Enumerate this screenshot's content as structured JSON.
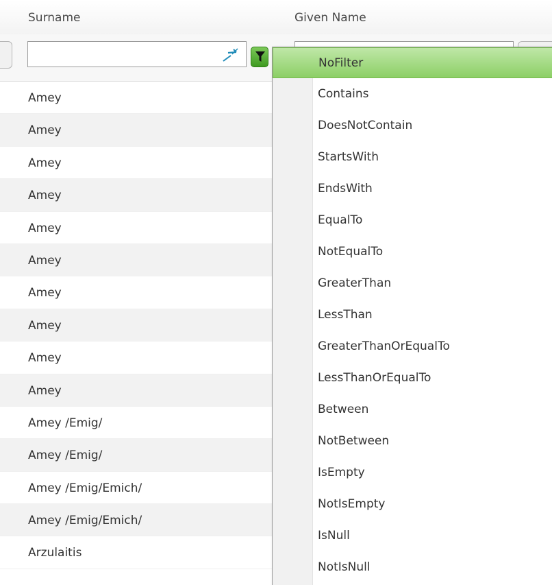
{
  "headers": {
    "surname": "Surname",
    "given_name": "Given Name"
  },
  "filter": {
    "surname_value": "",
    "given_value": "",
    "active_color": "#5fb33b"
  },
  "rows": [
    "Amey",
    "Amey",
    "Amey",
    "Amey",
    "Amey",
    "Amey",
    "Amey",
    "Amey",
    "Amey",
    "Amey",
    "Amey /Emig/",
    "Amey /Emig/",
    "Amey /Emig/Emich/",
    "Amey /Emig/Emich/",
    "Arzulaitis"
  ],
  "menu": {
    "selected": "NoFilter",
    "items": [
      "NoFilter",
      "Contains",
      "DoesNotContain",
      "StartsWith",
      "EndsWith",
      "EqualTo",
      "NotEqualTo",
      "GreaterThan",
      "LessThan",
      "GreaterThanOrEqualTo",
      "LessThanOrEqualTo",
      "Between",
      "NotBetween",
      "IsEmpty",
      "NotIsEmpty",
      "IsNull",
      "NotIsNull"
    ]
  },
  "icons": {
    "clear": "clear-filter-icon",
    "funnel": "funnel-icon"
  }
}
